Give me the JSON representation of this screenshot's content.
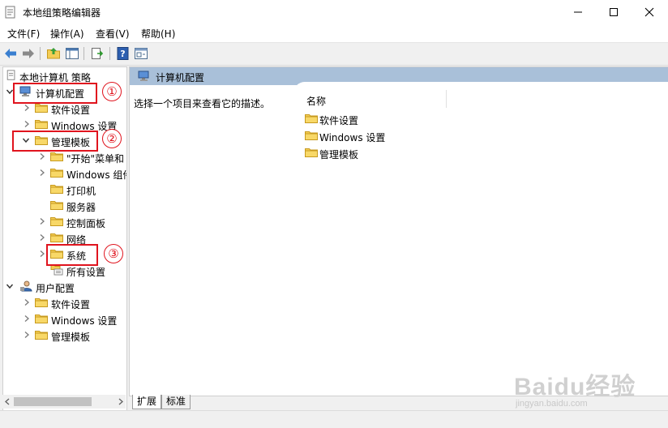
{
  "window": {
    "title": "本地组策略编辑器"
  },
  "menu": [
    "文件(F)",
    "操作(A)",
    "查看(V)",
    "帮助(H)"
  ],
  "tree": {
    "root": "本地计算机 策略",
    "computer_config": "计算机配置",
    "cc_software": "软件设置",
    "cc_windows": "Windows 设置",
    "admin_templates": "管理模板",
    "at_start_menu": "\"开始\"菜单和",
    "at_windows_comp": "Windows 组件",
    "at_printers": "打印机",
    "at_server": "服务器",
    "at_control_panel": "控制面板",
    "at_network": "网络",
    "at_system": "系统",
    "at_all_settings": "所有设置",
    "user_config": "用户配置",
    "uc_software": "软件设置",
    "uc_windows": "Windows 设置",
    "uc_admin": "管理模板"
  },
  "right": {
    "header": "计算机配置",
    "description": "选择一个项目来查看它的描述。",
    "column_name": "名称",
    "items": [
      "软件设置",
      "Windows 设置",
      "管理模板"
    ]
  },
  "tabs": [
    "扩展",
    "标准"
  ],
  "annotations": [
    "①",
    "②",
    "③"
  ],
  "watermark": {
    "brand": "Baidu经验",
    "url": "jingyan.baidu.com"
  },
  "colors": {
    "header_bg": "#a9c0d9",
    "annotation_red": "#e0141e",
    "folder_yellow": "#f2c84b"
  }
}
